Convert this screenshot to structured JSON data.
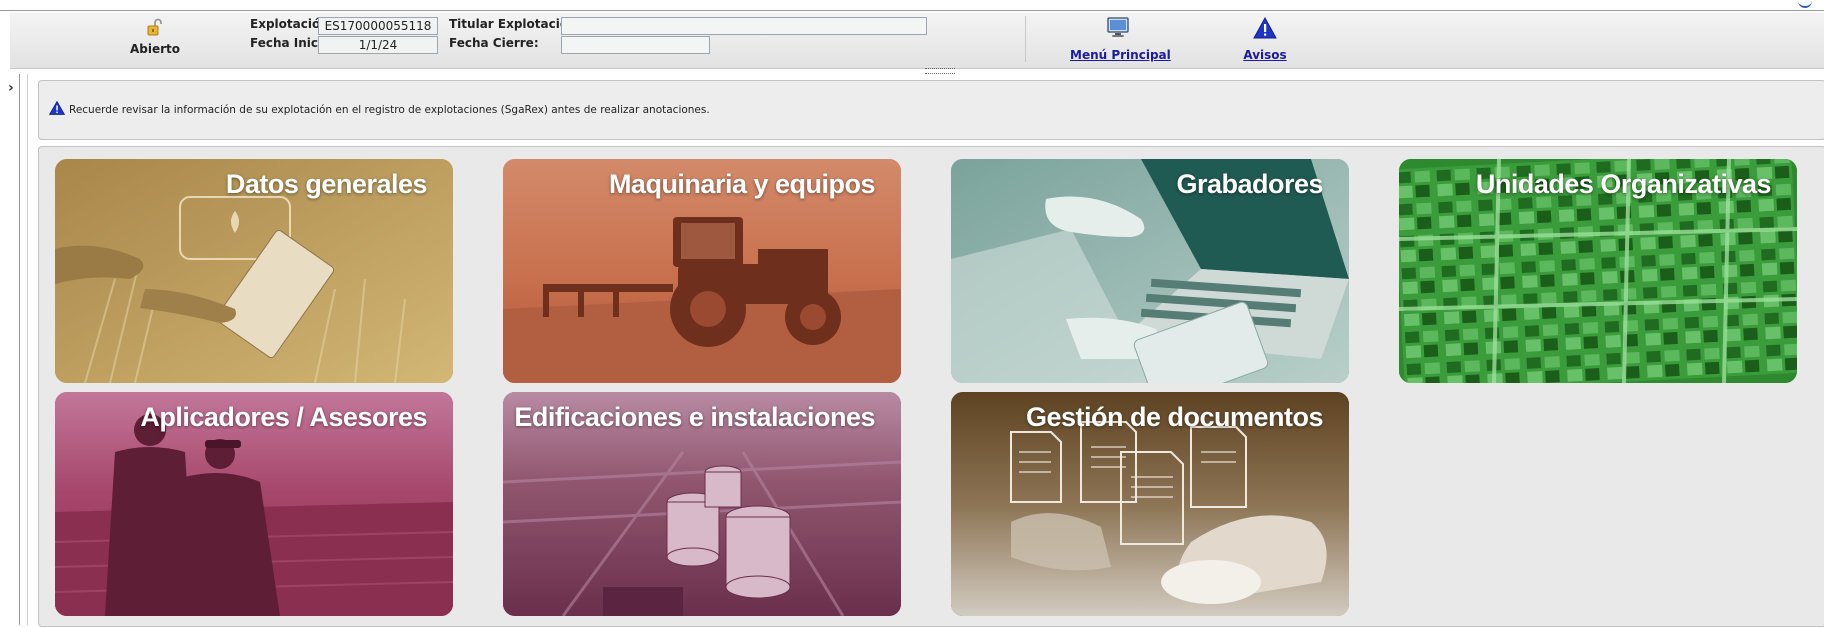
{
  "header": {
    "status_label": "Abierto",
    "explotacion_label": "Explotación :",
    "explotacion_value": "ES170000055118",
    "fecha_inicio_label": "Fecha Inicio:",
    "fecha_inicio_value": "1/1/24",
    "titular_label": "Titular Explotación :",
    "titular_value": "",
    "fecha_cierre_label": "Fecha Cierre:",
    "fecha_cierre_value": "",
    "menu_principal_label": "Menú Principal",
    "avisos_label": "Avisos"
  },
  "notice": {
    "text": "Recuerde revisar la información de su explotación en el registro de explotaciones (SgaRex) antes de realizar anotaciones."
  },
  "tiles": [
    {
      "title": "Datos generales",
      "color": "#b99a5a"
    },
    {
      "title": "Maquinaria y equipos",
      "color": "#c46a48"
    },
    {
      "title": "Grabadores",
      "color": "#5f8e87"
    },
    {
      "title": "Unidades Organizativas",
      "color": "#2f8a2f"
    },
    {
      "title": "Aplicadores / Asesores",
      "color": "#9a3c5c"
    },
    {
      "title": "Edificaciones e instalaciones",
      "color": "#844866"
    },
    {
      "title": "Gestión de documentos",
      "color": "#6c4f2c"
    }
  ],
  "icons": {
    "status": "open-lock-icon",
    "menu": "monitor-icon",
    "avisos": "warning-icon"
  }
}
